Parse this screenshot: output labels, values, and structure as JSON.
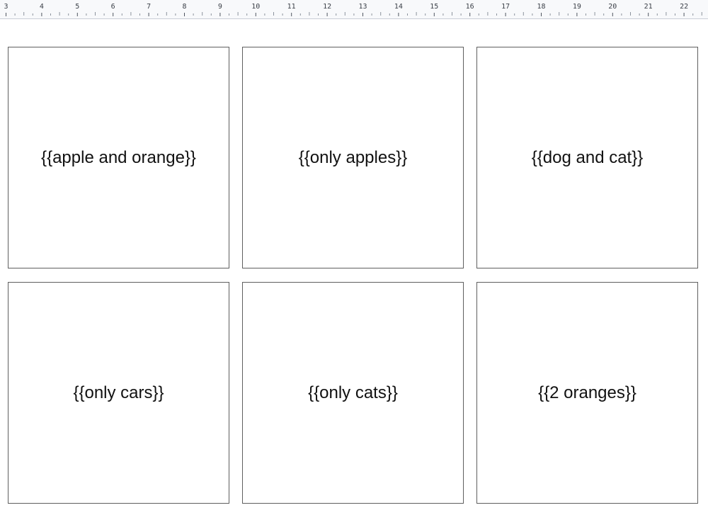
{
  "ruler": {
    "labels": [
      "3",
      "4",
      "5",
      "6",
      "7",
      "8",
      "9",
      "10",
      "11",
      "12",
      "13",
      "14",
      "15",
      "16",
      "17",
      "18",
      "19",
      "20",
      "21",
      "22"
    ]
  },
  "cards": [
    {
      "label": "{{apple and orange}}"
    },
    {
      "label": "{{only apples}}"
    },
    {
      "label": "{{dog and cat}}"
    },
    {
      "label": "{{only cars}}"
    },
    {
      "label": "{{only cats}}"
    },
    {
      "label": "{{2 oranges}}"
    }
  ]
}
